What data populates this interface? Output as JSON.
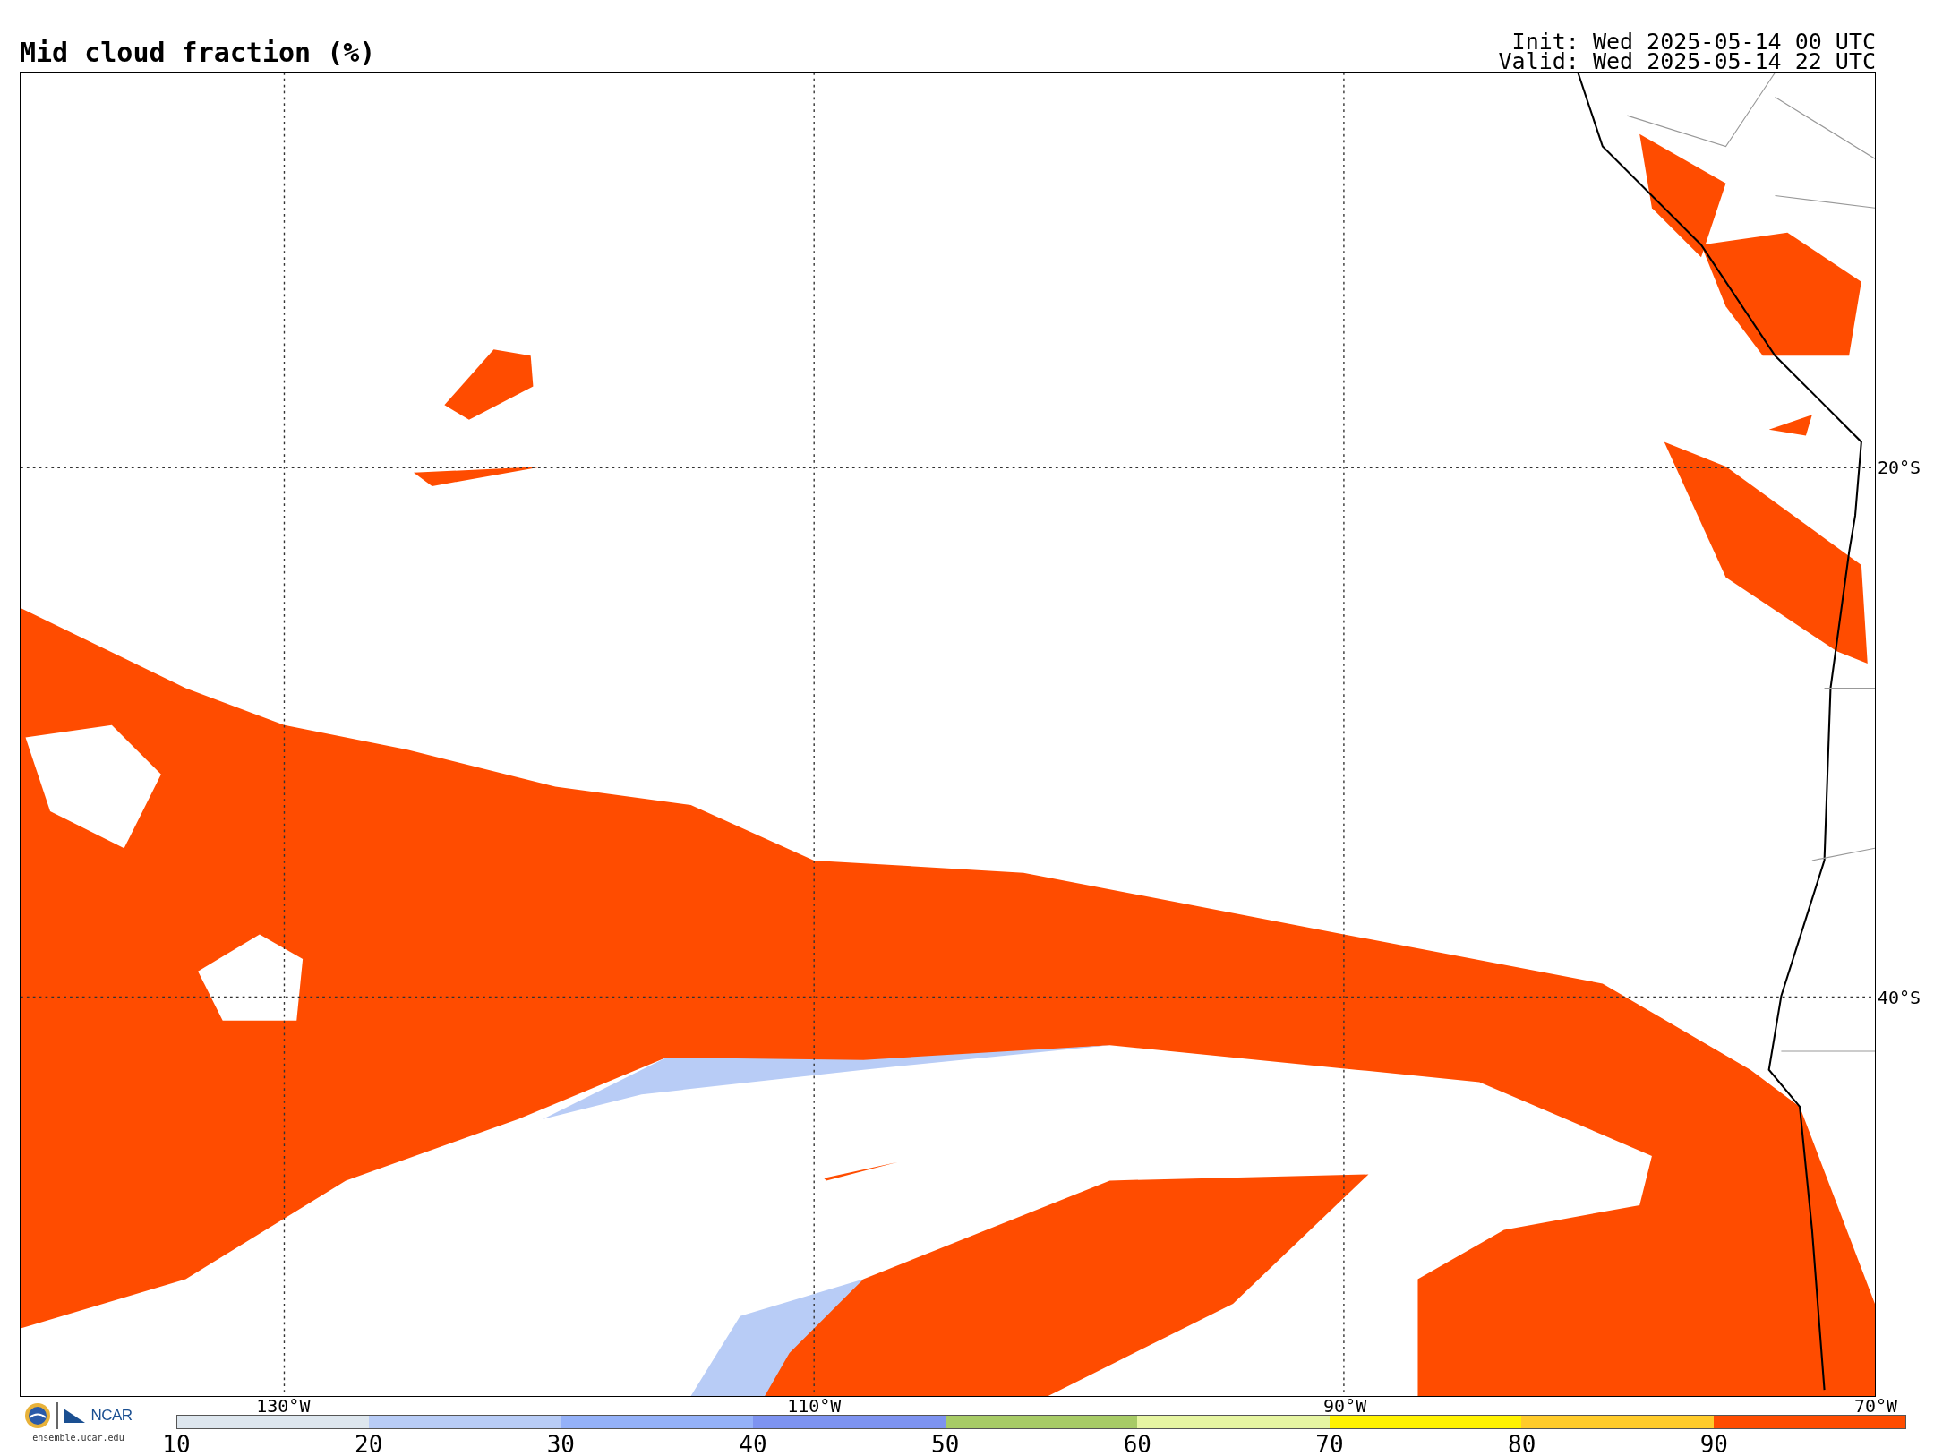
{
  "title": "Mid cloud fraction (%)",
  "init": "Init: Wed 2025-05-14 00 UTC",
  "valid": "Valid: Wed 2025-05-14 22 UTC",
  "map": {
    "longitude_labels": [
      "130°W",
      "110°W",
      "90°W",
      "70°W"
    ],
    "latitude_labels": [
      "20°S",
      "40°S"
    ]
  },
  "colorbar": {
    "bins": [
      {
        "color": "#dde6ee"
      },
      {
        "color": "#b8ccf6"
      },
      {
        "color": "#94b1f8"
      },
      {
        "color": "#7d93f0"
      },
      {
        "color": "#a7cb66"
      },
      {
        "color": "#e6f5a2"
      },
      {
        "color": "#fff200"
      },
      {
        "color": "#ffcb2a"
      },
      {
        "color": "#ff4c00"
      }
    ],
    "ticks": [
      "10",
      "20",
      "30",
      "40",
      "50",
      "60",
      "70",
      "80",
      "90"
    ]
  },
  "footer": {
    "logo_text": "NCAR",
    "url": "ensemble.ucar.edu"
  }
}
